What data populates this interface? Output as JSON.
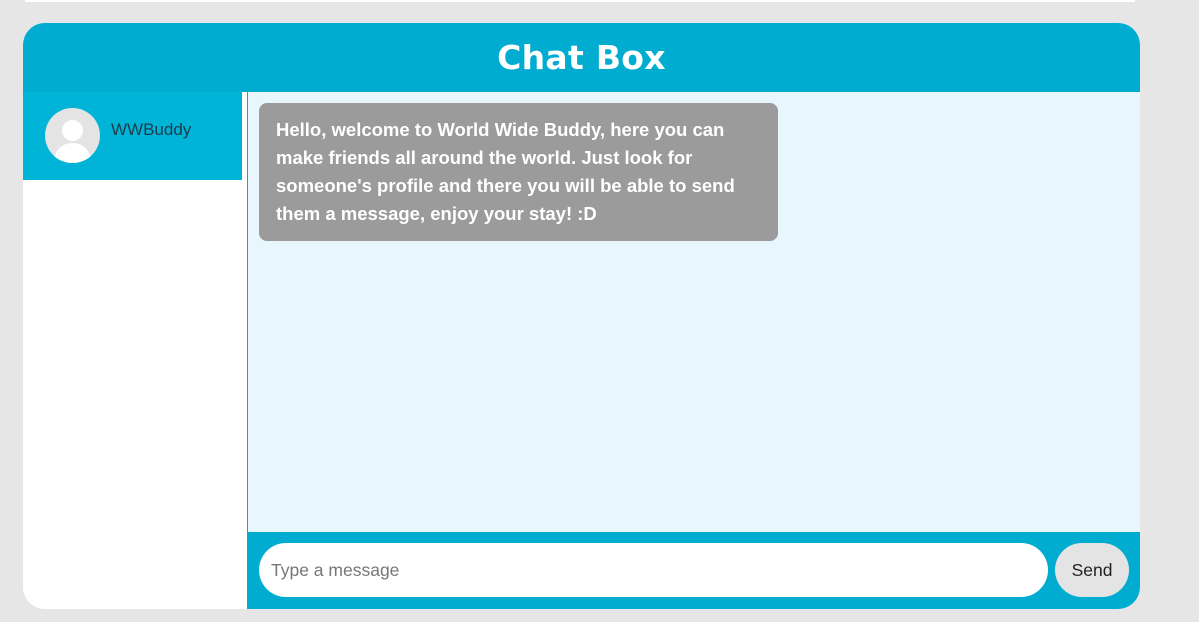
{
  "header": {
    "title": "Chat Box"
  },
  "sidebar": {
    "contacts": [
      {
        "name": "WWBuddy",
        "avatar_icon": "user-avatar-icon"
      }
    ]
  },
  "messages": [
    {
      "text": "Hello, welcome to World Wide Buddy, here you can make friends all around the world. Just look for someone's profile and there you will be able to send them a message, enjoy your stay! :D"
    }
  ],
  "composer": {
    "input_value": "",
    "input_placeholder": "Type a message",
    "send_label": "Send"
  },
  "colors": {
    "accent": "#00acd0",
    "contact_active": "#00b4d8",
    "messages_background": "#e8f7fe",
    "bubble": "#9b9b9b",
    "page_background": "#e6e6e6"
  }
}
